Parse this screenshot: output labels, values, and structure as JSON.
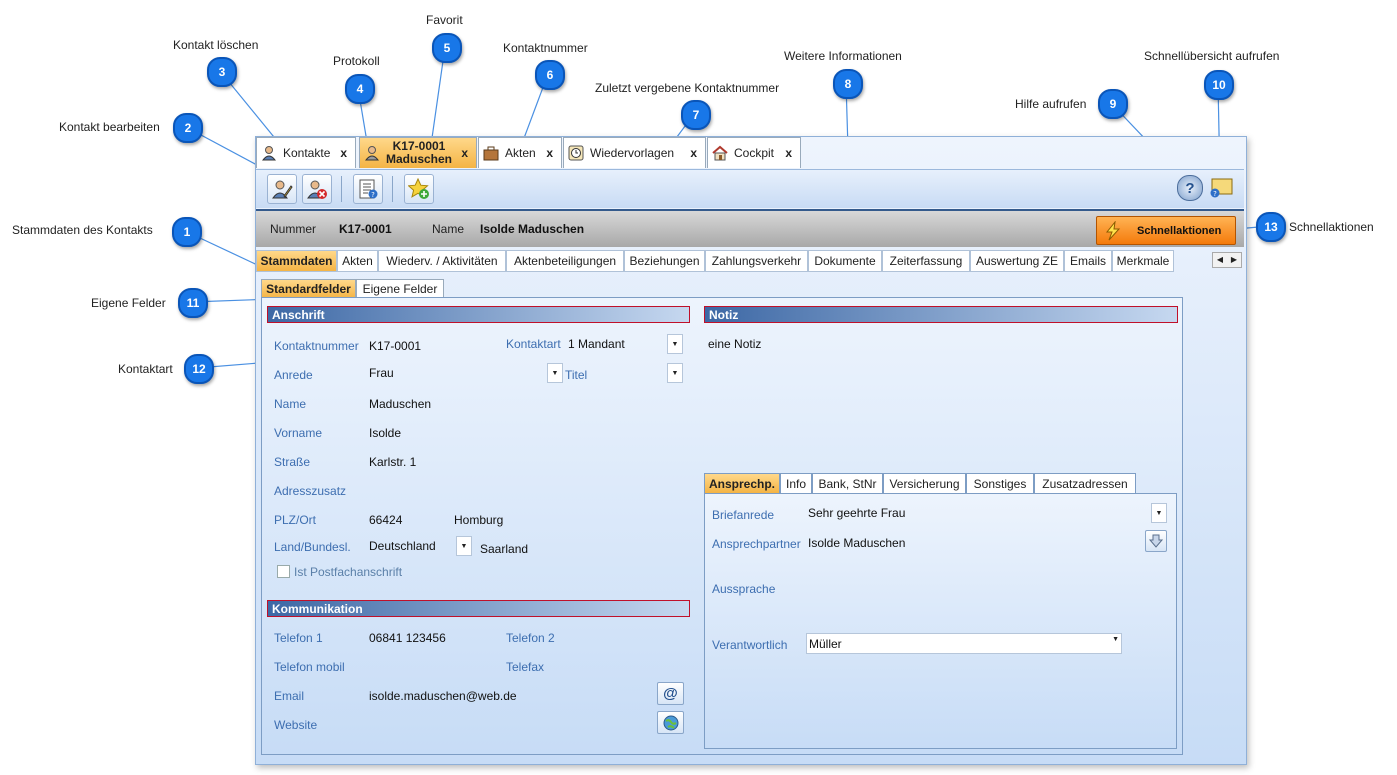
{
  "annotations": [
    {
      "num": "1",
      "label": "Stammdaten des Kontakts"
    },
    {
      "num": "2",
      "label": "Kontakt bearbeiten"
    },
    {
      "num": "3",
      "label": "Kontakt löschen"
    },
    {
      "num": "4",
      "label": "Protokoll"
    },
    {
      "num": "5",
      "label": "Favorit"
    },
    {
      "num": "6",
      "label": "Kontaktnummer"
    },
    {
      "num": "7",
      "label": "Zuletzt vergebene Kontaktnummer"
    },
    {
      "num": "8",
      "label": "Weitere Informationen"
    },
    {
      "num": "9",
      "label": "Hilfe aufrufen"
    },
    {
      "num": "10",
      "label": "Schnellübersicht aufrufen"
    },
    {
      "num": "11",
      "label": "Eigene Felder"
    },
    {
      "num": "12",
      "label": "Kontaktart"
    },
    {
      "num": "13",
      "label": "Schnellaktionen"
    }
  ],
  "doc_tabs": [
    {
      "label": "Kontakte",
      "close": "x",
      "icon": "contacts-icon"
    },
    {
      "label": "K17-0001 Maduschen",
      "line1": "K17-0001",
      "line2": "Maduschen",
      "close": "x",
      "icon": "contact-icon"
    },
    {
      "label": "Akten",
      "close": "x",
      "icon": "briefcase-icon"
    },
    {
      "label": "Wiedervorlagen",
      "close": "x",
      "icon": "clock-icon"
    },
    {
      "label": "Cockpit",
      "close": "x",
      "icon": "home-icon"
    }
  ],
  "header": {
    "nummer_label": "Nummer",
    "nummer_value": "K17-0001",
    "name_label": "Name",
    "name_value": "Isolde Maduschen",
    "quick_actions": "Schnellaktionen"
  },
  "main_tabs": [
    "Stammdaten",
    "Akten",
    "Wiederv. / Aktivitäten",
    "Aktenbeteiligungen",
    "Beziehungen",
    "Zahlungsverkehr",
    "Dokumente",
    "Zeiterfassung",
    "Auswertung ZE",
    "Emails",
    "Merkmale"
  ],
  "sub_tabs": [
    "Standardfelder",
    "Eigene Felder"
  ],
  "anschrift": {
    "title": "Anschrift",
    "kontaktnummer_label": "Kontaktnummer",
    "kontaktnummer_value": "K17-0001",
    "kontaktart_label": "Kontaktart",
    "kontaktart_value": "1 Mandant",
    "anrede_label": "Anrede",
    "anrede_value": "Frau",
    "titel_label": "Titel",
    "name_label": "Name",
    "name_value": "Maduschen",
    "vorname_label": "Vorname",
    "vorname_value": "Isolde",
    "strasse_label": "Straße",
    "strasse_value": "Karlstr. 1",
    "adresszusatz_label": "Adresszusatz",
    "plz_label": "PLZ/Ort",
    "plz_value": "66424",
    "ort_value": "Homburg",
    "land_label": "Land/Bundesl.",
    "land_value": "Deutschland",
    "bundesland_value": "Saarland",
    "postfach_label": "Ist Postfachanschrift"
  },
  "kommunikation": {
    "title": "Kommunikation",
    "telefon1_label": "Telefon 1",
    "telefon1_value": "06841 123456",
    "telefon2_label": "Telefon 2",
    "mobil_label": "Telefon mobil",
    "telefax_label": "Telefax",
    "email_label": "Email",
    "email_value": "isolde.maduschen@web.de",
    "website_label": "Website"
  },
  "notiz": {
    "title": "Notiz",
    "text": "eine Notiz"
  },
  "person_tabs": [
    "Ansprechp.",
    "Info",
    "Bank, StNr",
    "Versicherung",
    "Sonstiges",
    "Zusatzadressen"
  ],
  "ansprech": {
    "briefanrede_label": "Briefanrede",
    "briefanrede_value": "Sehr geehrte Frau",
    "ansprechpartner_label": "Ansprechpartner",
    "ansprechpartner_value": "Isolde Maduschen",
    "aussprache_label": "Aussprache",
    "verantwortlich_label": "Verantwortlich",
    "verantwortlich_value": "Müller"
  },
  "colors": {
    "accent": "#1877e8",
    "tab_active": "#f4b445",
    "section_border": "#c0102a"
  }
}
